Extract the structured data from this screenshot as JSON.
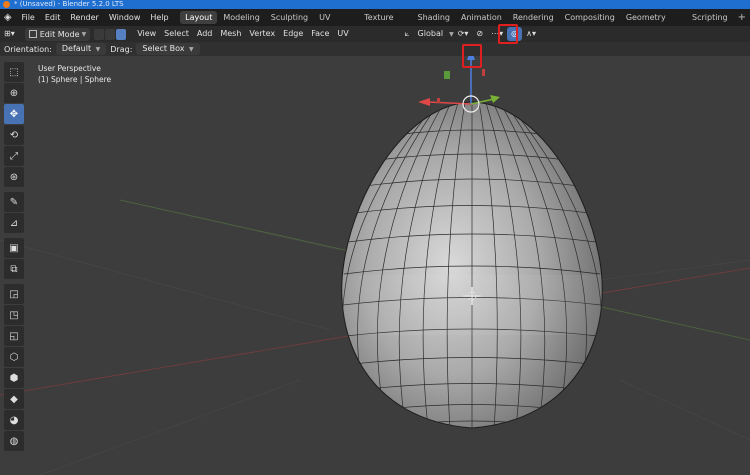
{
  "window": {
    "title": "* (Unsaved) - Blender 5.2.0 LTS"
  },
  "menu": {
    "items": [
      "File",
      "Edit",
      "Render",
      "Window",
      "Help"
    ]
  },
  "workspaces": {
    "tabs": [
      "Layout",
      "Modeling",
      "Sculpting",
      "UV Editing",
      "Texture Paint",
      "Shading",
      "Animation",
      "Rendering",
      "Compositing",
      "Geometry Nodes",
      "Scripting"
    ],
    "active": "Layout",
    "add_label": "+"
  },
  "header": {
    "mode": "Edit Mode",
    "menus": [
      "View",
      "Select",
      "Add",
      "Mesh",
      "Vertex",
      "Edge",
      "Face",
      "UV"
    ],
    "orientation_value": "Global"
  },
  "toolsettings": {
    "orientation_label": "Orientation:",
    "orientation_value": "Default",
    "drag_label": "Drag:",
    "drag_value": "Select Box"
  },
  "viewport": {
    "perspective": "User Perspective",
    "object": "(1) Sphere | Sphere"
  },
  "colors": {
    "title_bar": "#1f6fd0",
    "accent": "#4772b3",
    "highlight": "#e02020",
    "gizmo_x": "#e04848",
    "gizmo_y": "#7ab236",
    "gizmo_z": "#4d7fe0"
  },
  "icons": [
    "select-box-icon",
    "cursor-icon",
    "move-icon",
    "rotate-icon",
    "scale-icon",
    "transform-icon",
    "annotate-icon",
    "measure-icon",
    "add-cube-icon",
    "extrude-icon",
    "inset-icon",
    "bevel-icon",
    "loop-cut-icon",
    "knife-icon",
    "poly-build-icon",
    "spin-icon",
    "smooth-icon",
    "shrink-icon"
  ]
}
